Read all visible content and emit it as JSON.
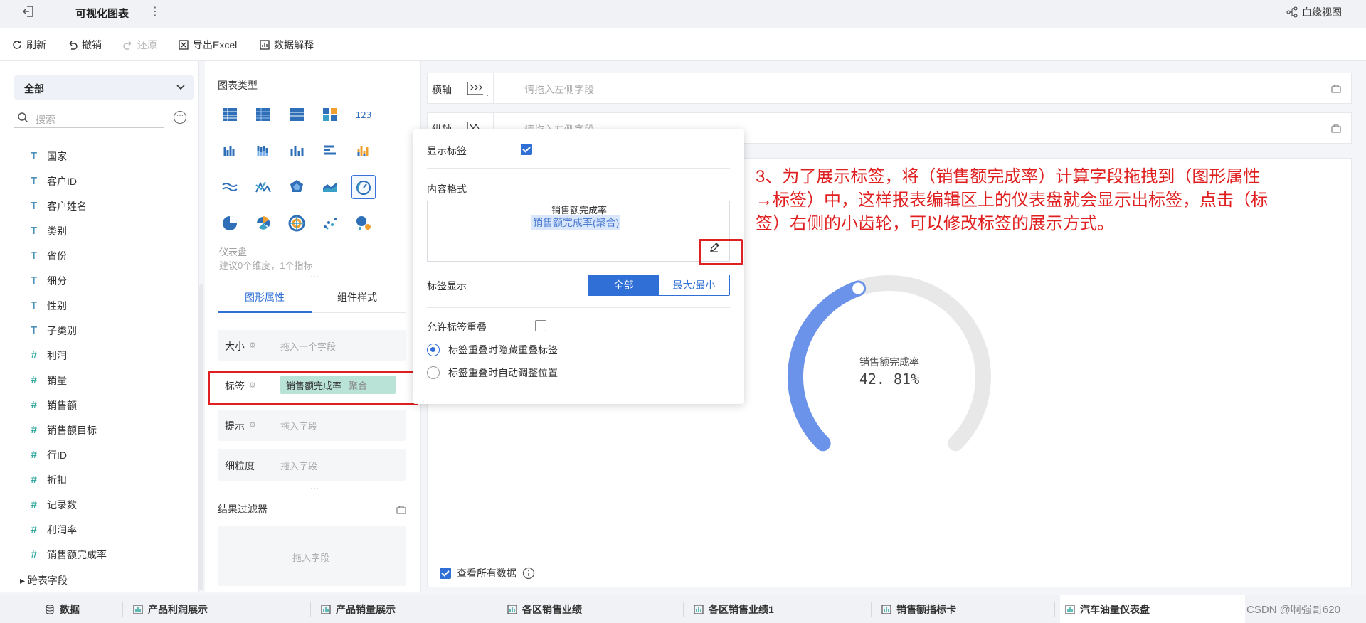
{
  "topbar": {
    "title": "可视化图表",
    "lineage_label": "血缘视图"
  },
  "toolbar": {
    "refresh": "刷新",
    "undo": "撤销",
    "redo": "还原",
    "export": "导出Excel",
    "explain": "数据解释"
  },
  "fields": {
    "selector": "全部",
    "search_placeholder": "搜索",
    "items": [
      {
        "type": "T",
        "name": "国家"
      },
      {
        "type": "T",
        "name": "客户ID"
      },
      {
        "type": "T",
        "name": "客户姓名"
      },
      {
        "type": "T",
        "name": "类别"
      },
      {
        "type": "T",
        "name": "省份"
      },
      {
        "type": "T",
        "name": "细分"
      },
      {
        "type": "T",
        "name": "性别"
      },
      {
        "type": "T",
        "name": "子类别"
      },
      {
        "type": "#",
        "name": "利润"
      },
      {
        "type": "#",
        "name": "销量"
      },
      {
        "type": "#",
        "name": "销售额"
      },
      {
        "type": "#",
        "name": "销售额目标"
      },
      {
        "type": "#",
        "name": "行ID"
      },
      {
        "type": "#",
        "name": "折扣"
      },
      {
        "type": "#",
        "name": "记录数"
      },
      {
        "type": "#",
        "name": "利润率"
      },
      {
        "type": "#",
        "name": "销售额完成率"
      }
    ],
    "cross_table": "跨表字段"
  },
  "chart_panel": {
    "title": "图表类型",
    "selected_name": "仪表盘",
    "selected_hint": "建议0个维度，1个指标",
    "tabs": [
      "图形属性",
      "组件样式"
    ],
    "props": {
      "size_label": "大小",
      "size_placeholder": "拖入一个字段",
      "label_label": "标签",
      "label_field": "销售额完成率",
      "label_agg": "聚合",
      "tip_label": "提示",
      "tip_placeholder": "拖入字段",
      "grain_label": "细粒度",
      "grain_placeholder": "拖入字段"
    },
    "filter_title": "结果过滤器",
    "filter_placeholder": "拖入字段"
  },
  "axes": {
    "x_label": "横轴",
    "x_placeholder": "请拖入左侧字段",
    "y_label": "纵轴",
    "y_placeholder": "请拖入左侧字段"
  },
  "popover": {
    "show_label": "显示标签",
    "content_format": "内容格式",
    "format_line1": "销售额完成率",
    "format_line2": "销售额完成率(聚合)",
    "label_display": "标签显示",
    "seg_all": "全部",
    "seg_minmax": "最大/最小",
    "allow_overlap": "允许标签重叠",
    "radio_hide": "标签重叠时隐藏重叠标签",
    "radio_adjust": "标签重叠时自动调整位置"
  },
  "annotation": "3、为了展示标签，将（销售额完成率）计算字段拖拽到（图形属性→标签）中，这样报表编辑区上的仪表盘就会显示出标签，点击（标签）右侧的小齿轮，可以修改标签的展示方式。",
  "gauge": {
    "label": "销售额完成率",
    "value_text": "42. 81%",
    "value_fraction": 0.4281,
    "track_color": "#e8e8e8",
    "fill_color": "#6b93ea"
  },
  "view_all": "查看所有数据",
  "bottom_tabs": [
    "数据",
    "产品利润展示",
    "产品销量展示",
    "各区销售业绩",
    "各区销售业绩1",
    "销售额指标卡",
    "汽车油量仪表盘"
  ],
  "watermark": "CSDN @啊强哥620"
}
